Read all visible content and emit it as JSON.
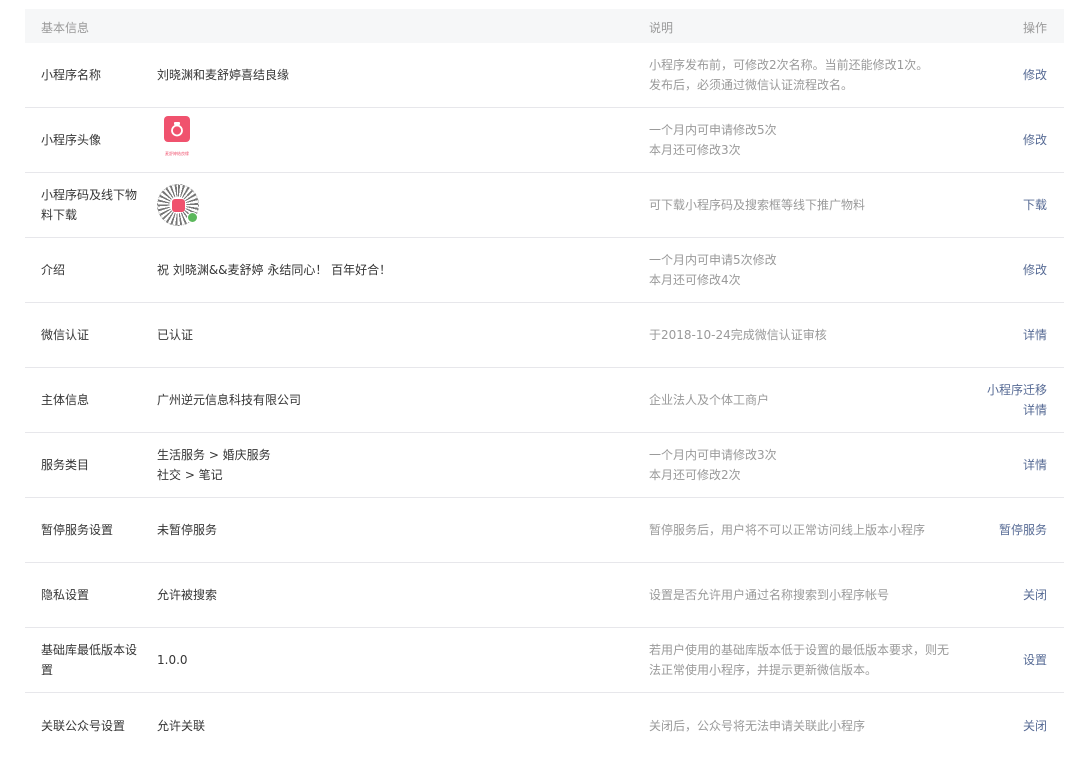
{
  "header": {
    "basic_info": "基本信息",
    "description": "说明",
    "operation": "操作"
  },
  "rows": [
    {
      "label": "小程序名称",
      "value": "刘晓渊和麦舒婷喜结良缘",
      "desc": [
        "小程序发布前，可修改2次名称。当前还能修改1次。",
        "发布后，必须通过微信认证流程改名。"
      ],
      "ops": [
        "修改"
      ]
    },
    {
      "label": "小程序头像",
      "value": "",
      "avatar_caption": "麦舒婷结良缘",
      "desc": [
        "一个月内可申请修改5次",
        "本月还可修改3次"
      ],
      "ops": [
        "修改"
      ]
    },
    {
      "label": "小程序码及线下物料下载",
      "value": "",
      "desc": [
        "可下载小程序码及搜索框等线下推广物料"
      ],
      "ops": [
        "下载"
      ]
    },
    {
      "label": "介绍",
      "value": "祝 刘晓渊&&麦舒婷 永结同心！ 百年好合！",
      "desc": [
        "一个月内可申请5次修改",
        "本月还可修改4次"
      ],
      "ops": [
        "修改"
      ]
    },
    {
      "label": "微信认证",
      "value": "已认证",
      "desc": [
        "于2018-10-24完成微信认证审核"
      ],
      "ops": [
        "详情"
      ]
    },
    {
      "label": "主体信息",
      "value": "广州逆元信息科技有限公司",
      "desc": [
        "企业法人及个体工商户"
      ],
      "ops": [
        "小程序迁移",
        "详情"
      ]
    },
    {
      "label": "服务类目",
      "value": [
        "生活服务 > 婚庆服务",
        "社交 > 笔记"
      ],
      "desc": [
        "一个月内可申请修改3次",
        "本月还可修改2次"
      ],
      "ops": [
        "详情"
      ]
    },
    {
      "label": "暂停服务设置",
      "value": "未暂停服务",
      "desc": [
        "暂停服务后，用户将不可以正常访问线上版本小程序"
      ],
      "ops": [
        "暂停服务"
      ]
    },
    {
      "label": "隐私设置",
      "value": "允许被搜索",
      "desc": [
        "设置是否允许用户通过名称搜索到小程序帐号"
      ],
      "ops": [
        "关闭"
      ]
    },
    {
      "label": "基础库最低版本设置",
      "value": "1.0.0",
      "desc": [
        "若用户使用的基础库版本低于设置的最低版本要求，则无",
        "法正常使用小程序，并提示更新微信版本。"
      ],
      "ops": [
        "设置"
      ]
    },
    {
      "label": "关联公众号设置",
      "value": "允许关联",
      "desc": [
        "关闭后，公众号将无法申请关联此小程序"
      ],
      "ops": [
        "关闭"
      ]
    }
  ]
}
